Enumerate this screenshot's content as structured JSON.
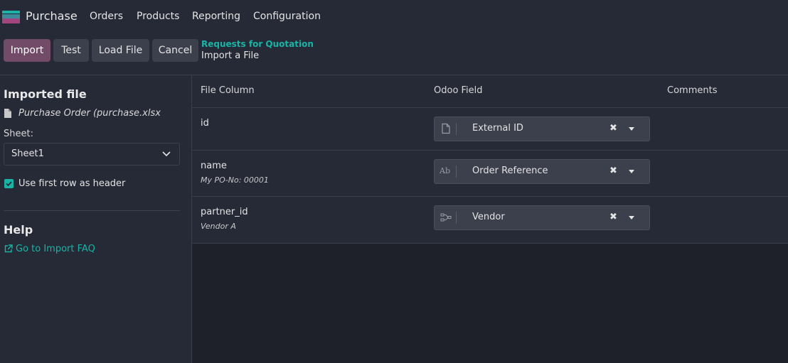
{
  "navbar": {
    "app_name": "Purchase",
    "menu": [
      "Orders",
      "Products",
      "Reporting",
      "Configuration"
    ]
  },
  "toolbar": {
    "import_label": "Import",
    "test_label": "Test",
    "load_file_label": "Load File",
    "cancel_label": "Cancel"
  },
  "breadcrumb": {
    "parent": "Requests for Quotation",
    "current": "Import a File"
  },
  "sidebar": {
    "imported_file_title": "Imported file",
    "file_name": "Purchase Order (purchase.xlsx",
    "sheet_label": "Sheet:",
    "sheet_value": "Sheet1",
    "header_checkbox_label": "Use first row as header",
    "header_checkbox_checked": true,
    "help_title": "Help",
    "faq_link": "Go to Import FAQ"
  },
  "table": {
    "headers": [
      "File Column",
      "Odoo Field",
      "Comments"
    ],
    "rows": [
      {
        "column": "id",
        "sample": "",
        "field": "External ID",
        "field_type_icon": "file-icon"
      },
      {
        "column": "name",
        "sample": "My PO-No: 00001",
        "field": "Order Reference",
        "field_type_icon": "text-ab-icon",
        "field_type_text": "Ab"
      },
      {
        "column": "partner_id",
        "sample": "Vendor A",
        "field": "Vendor",
        "field_type_icon": "relation-icon"
      }
    ],
    "clear_glyph": "✖"
  },
  "colors": {
    "primary": "#714b67",
    "accent": "#1ab3a6",
    "background": "#262a36",
    "empty_area": "#1e202a"
  }
}
